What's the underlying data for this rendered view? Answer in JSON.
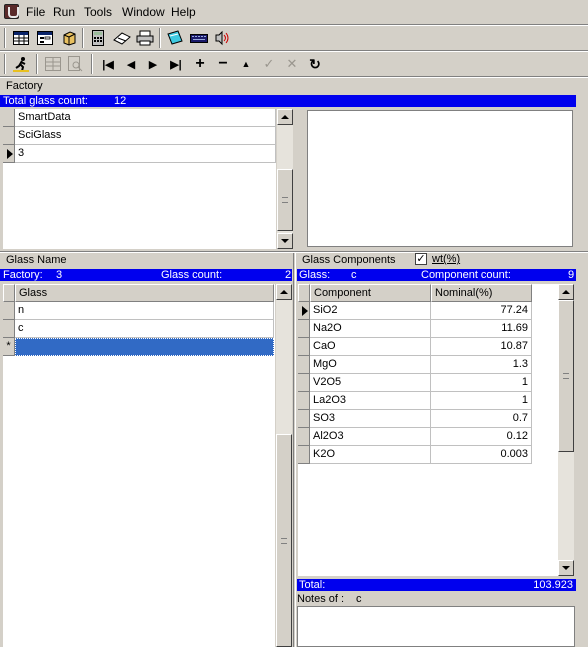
{
  "menu": [
    "File",
    "Run",
    "Tools",
    "Window",
    "Help"
  ],
  "toolbar1_icons": [
    "table-icon",
    "form-icon",
    "cube-icon",
    "calculator-icon",
    "eraser-icon",
    "printer-icon",
    "notebook-icon",
    "keyboard-icon",
    "speaker-icon"
  ],
  "toolbar2": {
    "run_icon": "running-man-icon",
    "disabled_icons": [
      "grid-icon",
      "preview-icon"
    ],
    "nav_glyphs": {
      "first": "|◀",
      "prev": "◀",
      "next": "▶",
      "last": "▶|",
      "add": "+",
      "delete": "−",
      "up": "▲",
      "check": "✓",
      "cancel": "✕",
      "refresh": "↻"
    }
  },
  "factory": {
    "title": "Factory",
    "total_label": "Total glass count:",
    "total_value": "12",
    "rows": [
      "SmartData",
      "SciGlass",
      "3"
    ]
  },
  "glass_name": {
    "title": "Glass Name",
    "factory_label": "Factory:",
    "factory_value": "3",
    "count_label": "Glass count:",
    "count_value": "2",
    "column": "Glass",
    "rows": [
      "n",
      "c",
      ""
    ],
    "new_row_marker": "*"
  },
  "components": {
    "title": "Glass Components",
    "wt_checked": "✓",
    "wt_label": "wt(%)",
    "glass_label": "Glass:",
    "glass_value": "c",
    "count_label": "Component count:",
    "count_value": "9",
    "columns": [
      "Component",
      "Nominal(%)"
    ],
    "rows": [
      {
        "name": "SiO2",
        "value": "77.24"
      },
      {
        "name": "Na2O",
        "value": "11.69"
      },
      {
        "name": "CaO",
        "value": "10.87"
      },
      {
        "name": "MgO",
        "value": "1.3"
      },
      {
        "name": "V2O5",
        "value": "1"
      },
      {
        "name": "La2O3",
        "value": "1"
      },
      {
        "name": "SO3",
        "value": "0.7"
      },
      {
        "name": "Al2O3",
        "value": "0.12"
      },
      {
        "name": "K2O",
        "value": "0.003"
      }
    ],
    "total_label": "Total:",
    "total_value": "103.923",
    "notes_label": "Notes of :",
    "notes_value": "c"
  },
  "colors": {
    "accent": "#0000ee",
    "selection": "#316ac5",
    "window": "#d4d0c8"
  }
}
